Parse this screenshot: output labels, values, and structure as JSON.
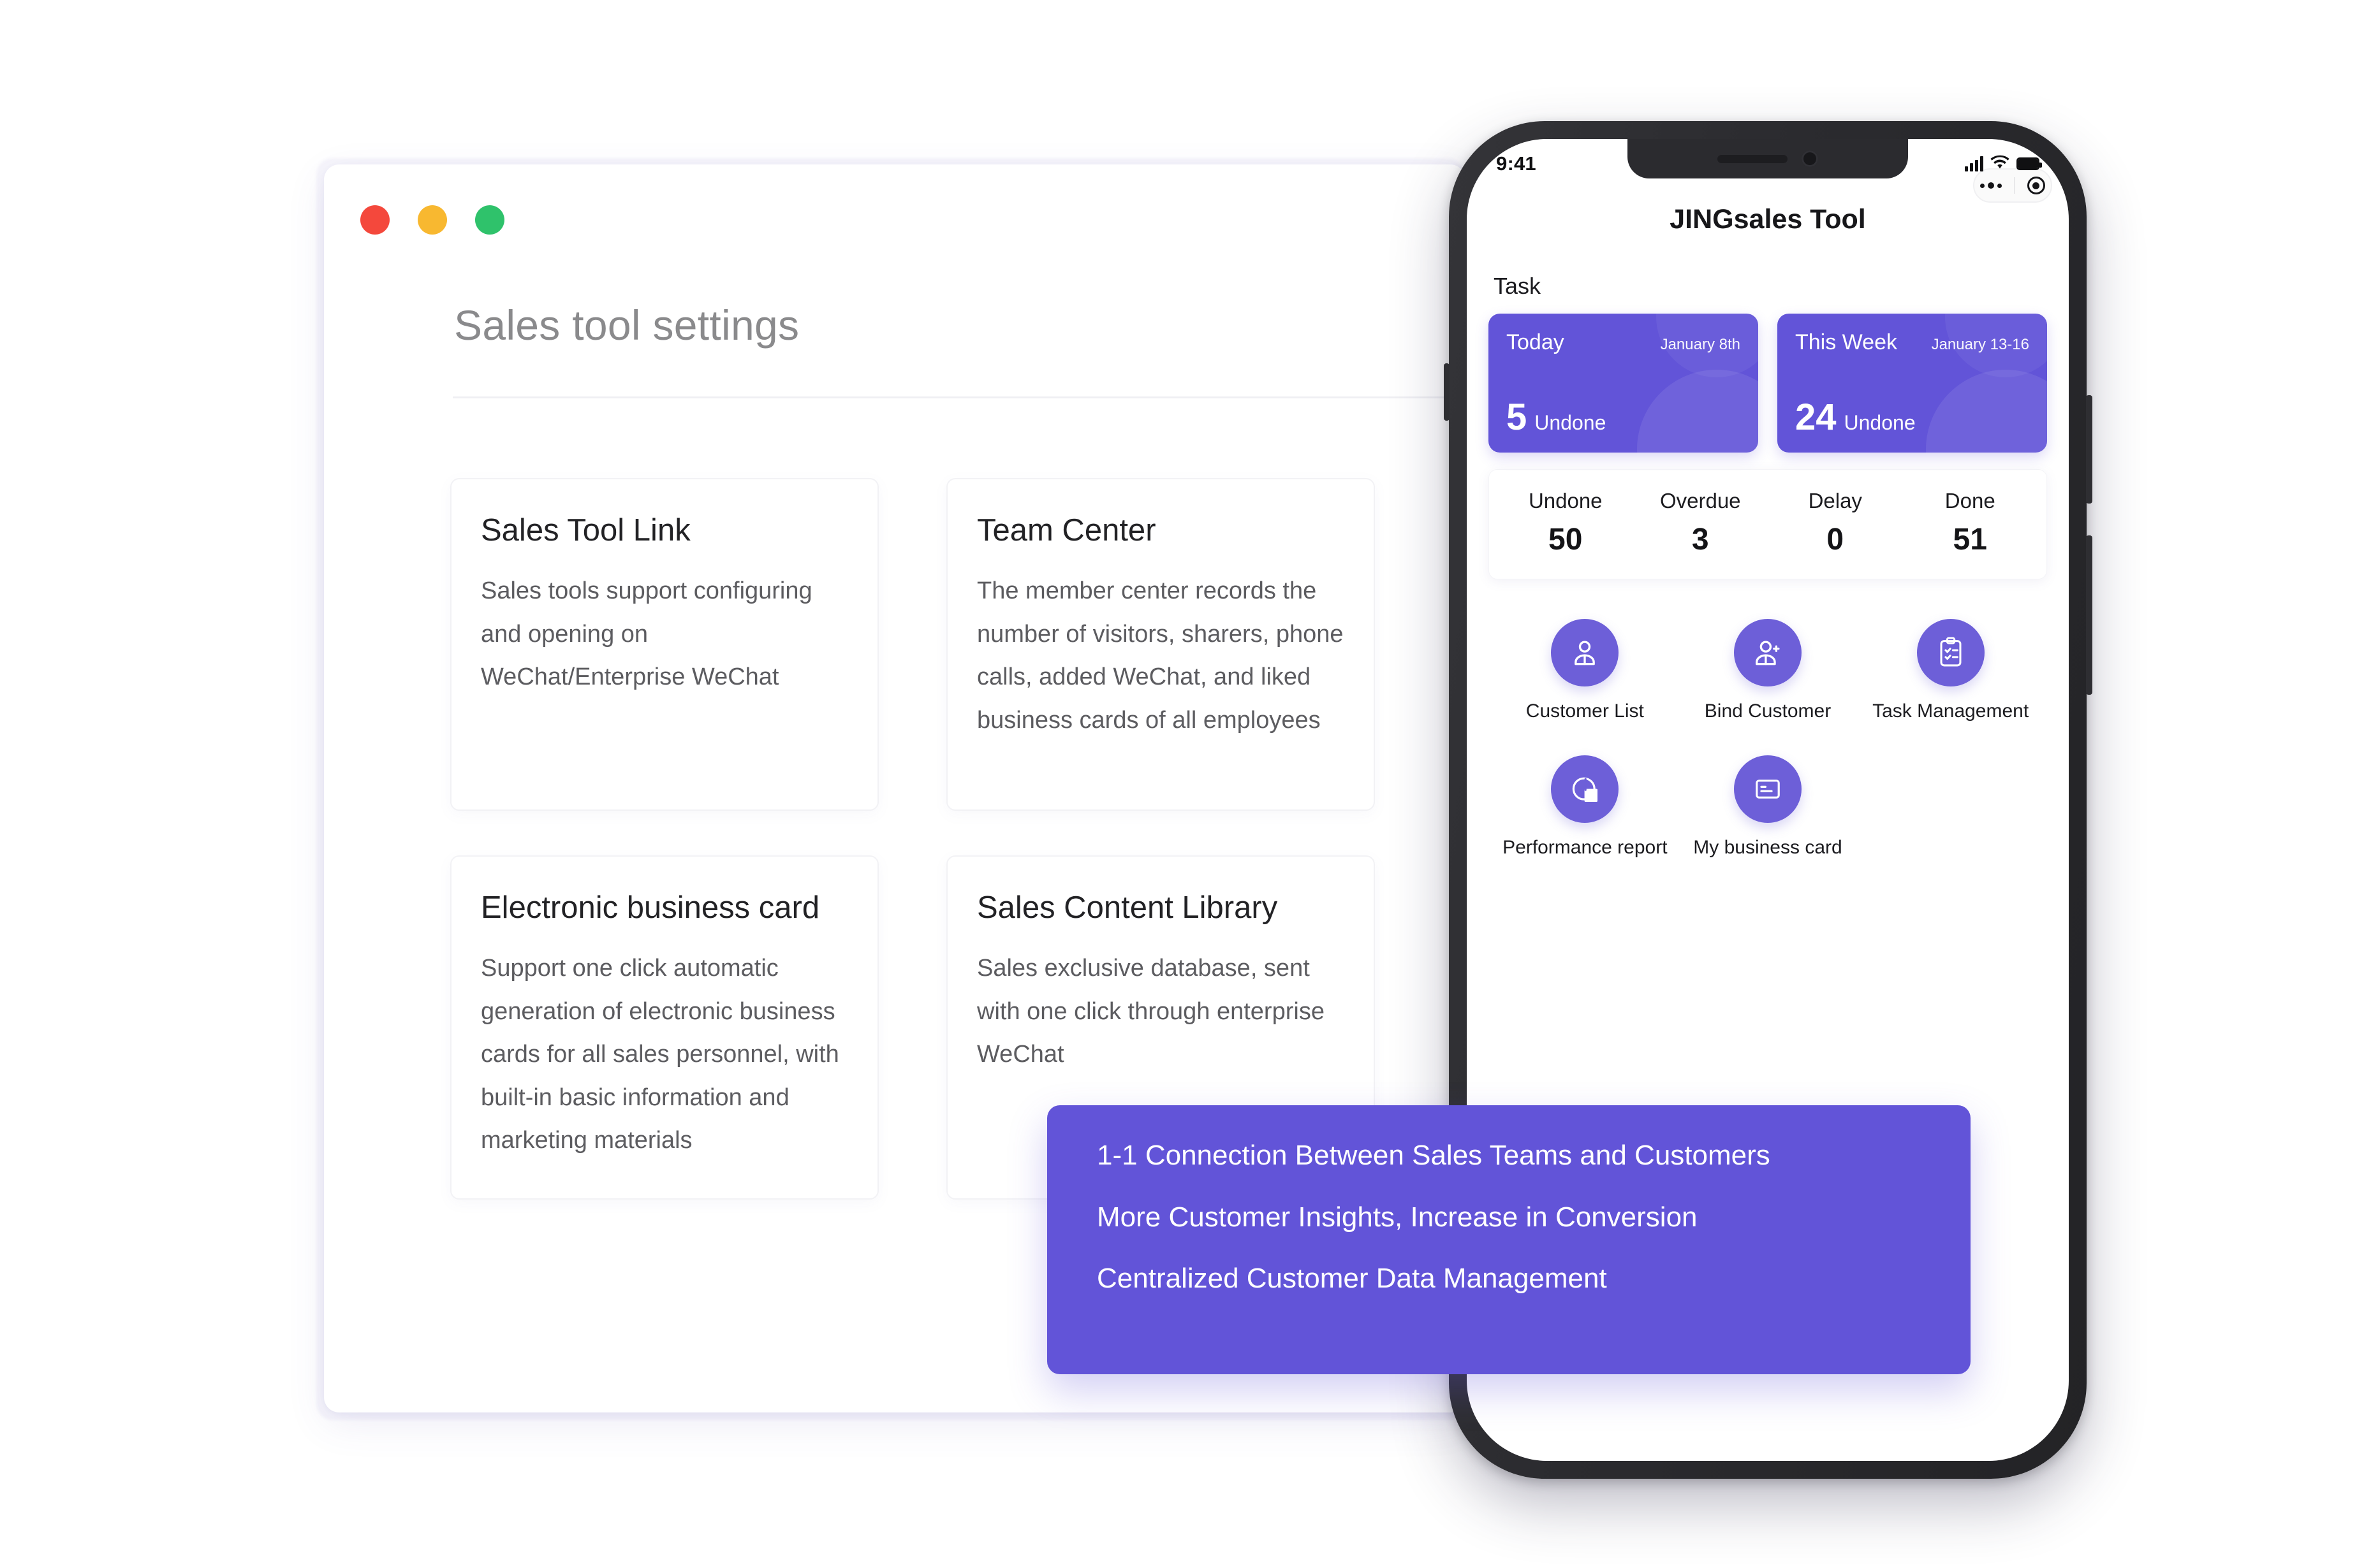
{
  "browser": {
    "traffic_lights": [
      "close",
      "minimize",
      "maximize"
    ],
    "page_title": "Sales tool settings",
    "cards": [
      {
        "title": "Sales Tool Link",
        "body": "Sales tools support configuring and opening on WeChat/Enterprise WeChat"
      },
      {
        "title": "Team Center",
        "body": "The member center records the number of visitors, sharers, phone calls, added WeChat, and liked business cards of all employees"
      },
      {
        "title": "Electronic business card",
        "body": "Support one click automatic generation of electronic business cards for all sales personnel, with built-in basic information and marketing materials"
      },
      {
        "title": "Sales Content Library",
        "body": "Sales exclusive database, sent with one click through enterprise WeChat"
      }
    ]
  },
  "phone": {
    "status_bar": {
      "time": "9:41",
      "signal": "signal-bars-icon",
      "wifi": "wifi-icon",
      "battery": "battery-icon"
    },
    "nav": {
      "title": "JINGsales Tool",
      "capsule_more": "more-dots-icon",
      "capsule_target": "target-icon"
    },
    "task_section": {
      "label": "Task",
      "cards": [
        {
          "name": "Today",
          "date": "January 8th",
          "count": "5",
          "unit": "Undone"
        },
        {
          "name": "This Week",
          "date": "January 13-16",
          "count": "24",
          "unit": "Undone"
        }
      ]
    },
    "stats": [
      {
        "label": "Undone",
        "value": "50"
      },
      {
        "label": "Overdue",
        "value": "3"
      },
      {
        "label": "Delay",
        "value": "0"
      },
      {
        "label": "Done",
        "value": "51"
      }
    ],
    "apps": [
      {
        "label": "Customer List",
        "icon": "user-icon"
      },
      {
        "label": "Bind Customer",
        "icon": "user-add-icon"
      },
      {
        "label": "Task Management",
        "icon": "clipboard-check-icon"
      },
      {
        "label": "Performance report",
        "icon": "pie-chart-icon"
      },
      {
        "label": "My business card",
        "icon": "card-icon"
      }
    ]
  },
  "callout": {
    "lines": [
      "1-1 Connection Between Sales Teams and Customers",
      "More Customer Insights, Increase in Conversion",
      "Centralized Customer Data Management"
    ]
  },
  "colors": {
    "accent_purple": "#6254d8",
    "icon_purple": "#6d5fd8",
    "traffic_red": "#f4483c",
    "traffic_yellow": "#f8b830",
    "traffic_green": "#2fc26b",
    "title_gray": "#8a8a8c",
    "body_gray": "#5c5c60"
  }
}
